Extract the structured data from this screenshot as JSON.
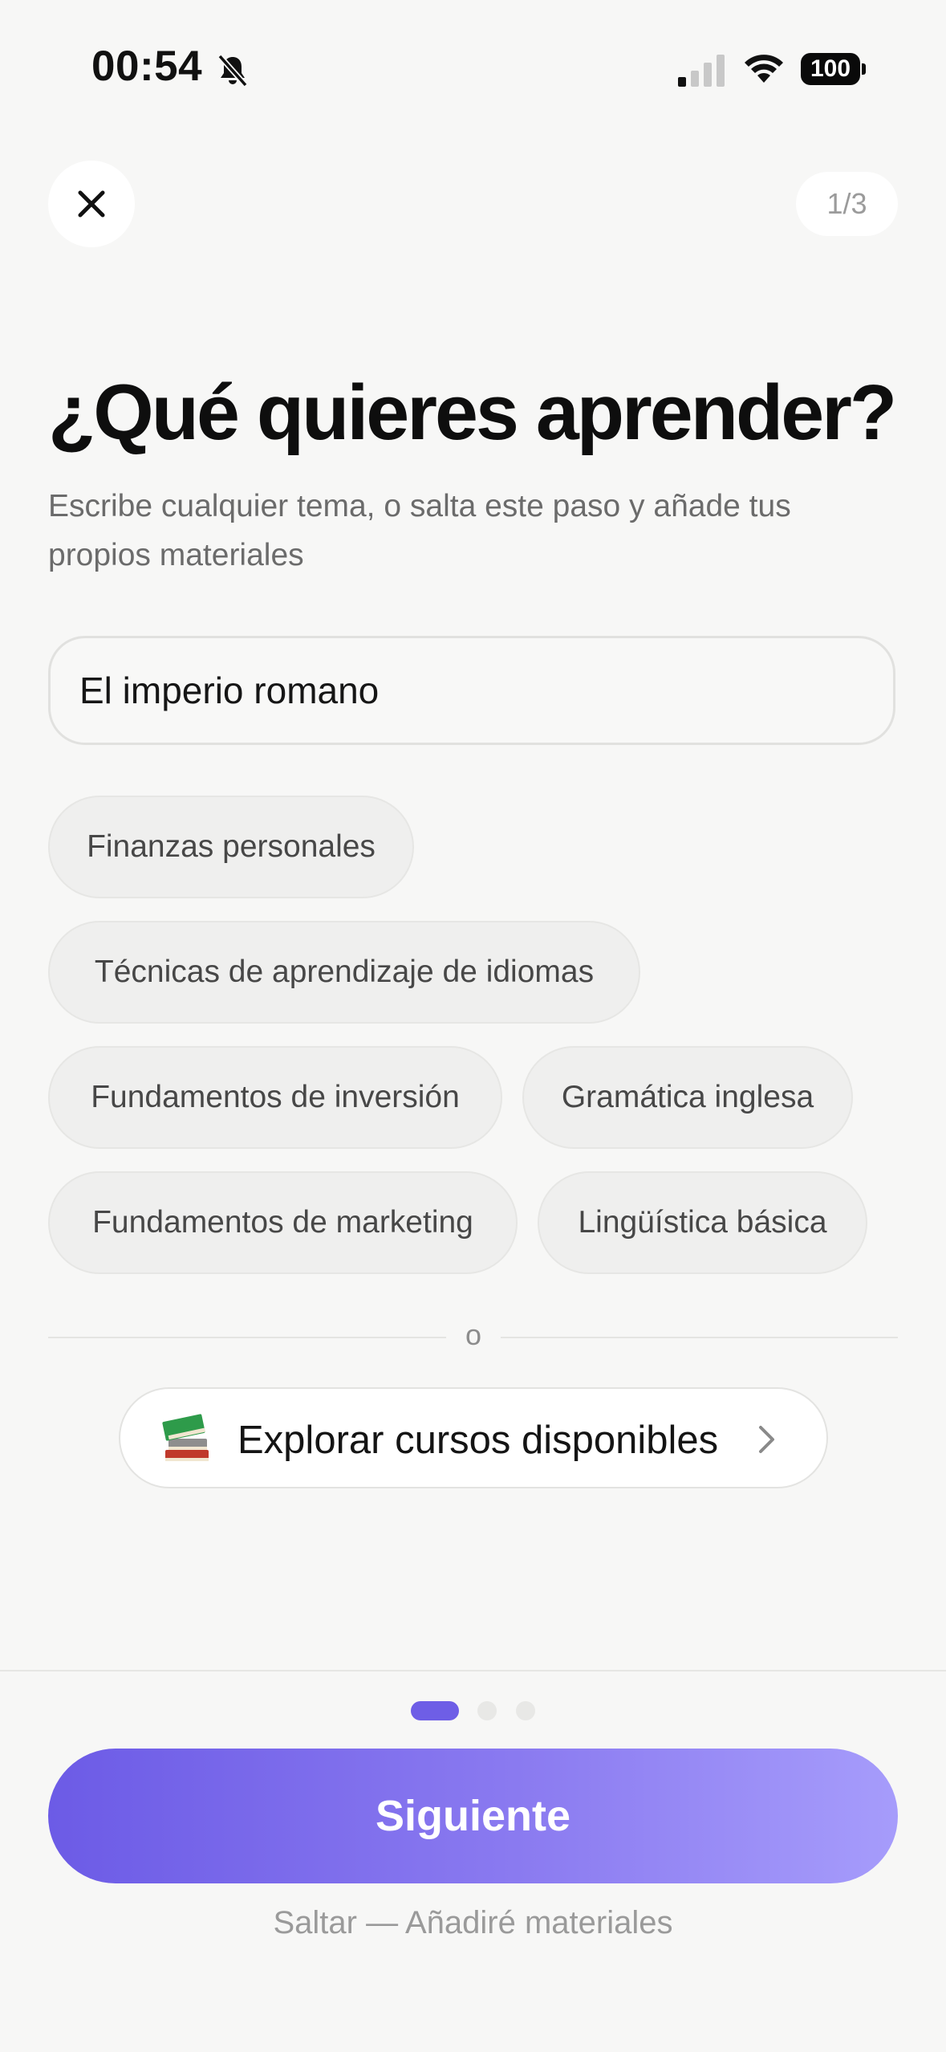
{
  "status_bar": {
    "time": "00:54",
    "battery": "100",
    "icons": [
      "bell-slash-icon",
      "cellular-signal-icon",
      "wifi-icon",
      "battery-icon"
    ]
  },
  "header": {
    "close_icon": "close-icon",
    "step": "1/3"
  },
  "main": {
    "title": "¿Qué quieres aprender?",
    "subtitle": "Escribe cualquier tema, o salta este paso y añade tus propios materiales",
    "topic_input": {
      "value": "El imperio romano",
      "placeholder": ""
    },
    "suggestions": [
      "Finanzas personales",
      "Técnicas de aprendizaje de idiomas",
      "Fundamentos de inversión",
      "Gramática inglesa",
      "Fundamentos de marketing",
      "Lingüística básica"
    ],
    "divider_text": "o",
    "explore_button": {
      "icon": "books-icon",
      "label": "Explorar cursos disponibles",
      "chevron": "chevron-right-icon"
    }
  },
  "footer": {
    "pagination": {
      "current": 1,
      "total": 3
    },
    "next_label": "Siguiente",
    "skip_label": "Saltar — Añadiré materiales"
  },
  "colors": {
    "background": "#f7f7f6",
    "accent": "#6e5ee6",
    "accent_light": "#a69cfb",
    "chip_bg": "#efefee"
  }
}
